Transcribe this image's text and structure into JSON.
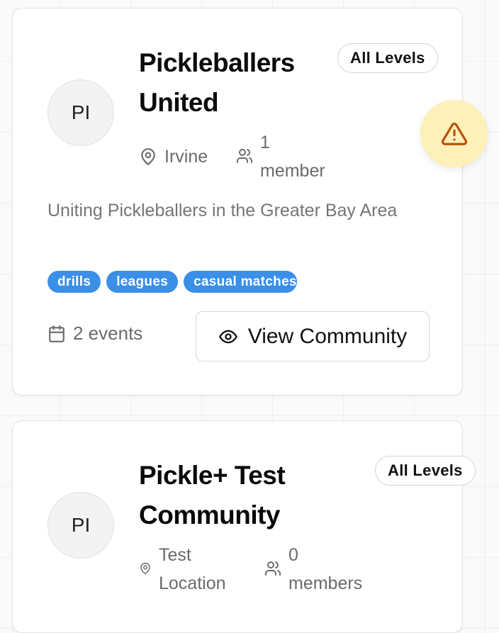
{
  "cards": [
    {
      "avatar": "PI",
      "title_line1": "Pickleballers",
      "title_line2": "United",
      "level": "All Levels",
      "location": "Irvine",
      "members_count": "1",
      "members_label": "member",
      "description": "Uniting Pickleballers in the Greater Bay Area",
      "tags": [
        "drills",
        "leagues",
        "casual matches"
      ],
      "events": "2 events",
      "view_button": "View Community"
    },
    {
      "avatar": "PI",
      "title_line1": "Pickle+ Test",
      "title_line2": "Community",
      "level": "All Levels",
      "location_line1": "Test",
      "location_line2": "Location",
      "members_count": "0",
      "members_label": "members"
    }
  ],
  "alert_button": {
    "icon": "warning-triangle-icon",
    "color": "#b45309",
    "background": "#fdf0b8"
  },
  "colors": {
    "tag": "#3b8fe6",
    "muted_text": "#6b6b6b"
  }
}
